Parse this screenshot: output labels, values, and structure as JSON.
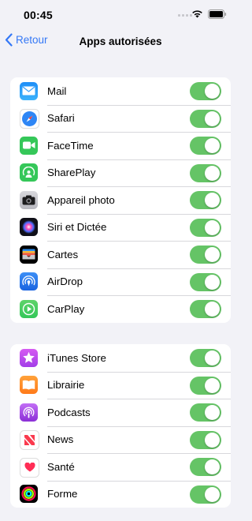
{
  "status_bar": {
    "time": "00:45"
  },
  "nav": {
    "back_label": "Retour",
    "title": "Apps autorisées"
  },
  "groups": [
    {
      "items": [
        {
          "label": "Mail",
          "icon": "mail-icon",
          "on": true
        },
        {
          "label": "Safari",
          "icon": "safari-icon",
          "on": true
        },
        {
          "label": "FaceTime",
          "icon": "facetime-icon",
          "on": true
        },
        {
          "label": "SharePlay",
          "icon": "shareplay-icon",
          "on": true
        },
        {
          "label": "Appareil photo",
          "icon": "camera-icon",
          "on": true
        },
        {
          "label": "Siri et Dictée",
          "icon": "siri-icon",
          "on": true
        },
        {
          "label": "Cartes",
          "icon": "wallet-icon",
          "on": true
        },
        {
          "label": "AirDrop",
          "icon": "airdrop-icon",
          "on": true
        },
        {
          "label": "CarPlay",
          "icon": "carplay-icon",
          "on": true
        }
      ]
    },
    {
      "items": [
        {
          "label": "iTunes Store",
          "icon": "itunes-store-icon",
          "on": true
        },
        {
          "label": "Librairie",
          "icon": "books-icon",
          "on": true
        },
        {
          "label": "Podcasts",
          "icon": "podcasts-icon",
          "on": true
        },
        {
          "label": "News",
          "icon": "news-icon",
          "on": true
        },
        {
          "label": "Santé",
          "icon": "health-icon",
          "on": true
        },
        {
          "label": "Forme",
          "icon": "fitness-icon",
          "on": true
        }
      ]
    }
  ],
  "colors": {
    "accent": "#3478f6",
    "toggle_on": "#65c466",
    "background": "#f2f2f7"
  }
}
